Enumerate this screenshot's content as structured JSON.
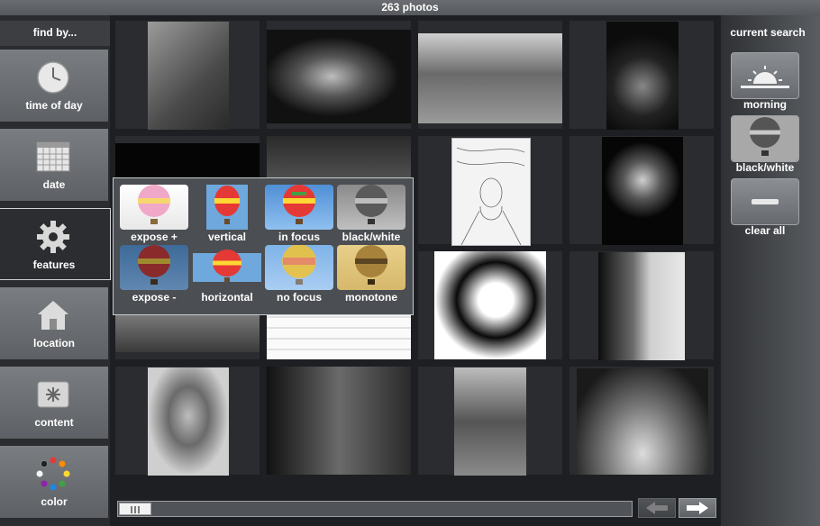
{
  "header": {
    "title": "263 photos"
  },
  "sidebar": {
    "find_by": "find by...",
    "items": [
      {
        "label": "time of day",
        "icon": "clock-icon"
      },
      {
        "label": "date",
        "icon": "calendar-icon"
      },
      {
        "label": "features",
        "icon": "gear-icon"
      },
      {
        "label": "location",
        "icon": "house-icon"
      },
      {
        "label": "content",
        "icon": "asterisk-icon"
      },
      {
        "label": "color",
        "icon": "color-wheel-icon"
      }
    ]
  },
  "features_popup": {
    "options": [
      {
        "label": "expose +"
      },
      {
        "label": "vertical"
      },
      {
        "label": "in focus"
      },
      {
        "label": "black/white"
      },
      {
        "label": "expose -"
      },
      {
        "label": "horizontal"
      },
      {
        "label": "no focus"
      },
      {
        "label": "monotone"
      }
    ]
  },
  "current_search": {
    "title": "current search",
    "chips": [
      {
        "label": "morning",
        "icon": "sunrise-icon"
      },
      {
        "label": "black/white",
        "icon": "balloon-icon"
      },
      {
        "label": "clear all",
        "icon": "minus-icon"
      }
    ]
  },
  "pagination": {
    "prev_icon": "left-arrow-icon",
    "next_icon": "right-arrow-icon"
  }
}
